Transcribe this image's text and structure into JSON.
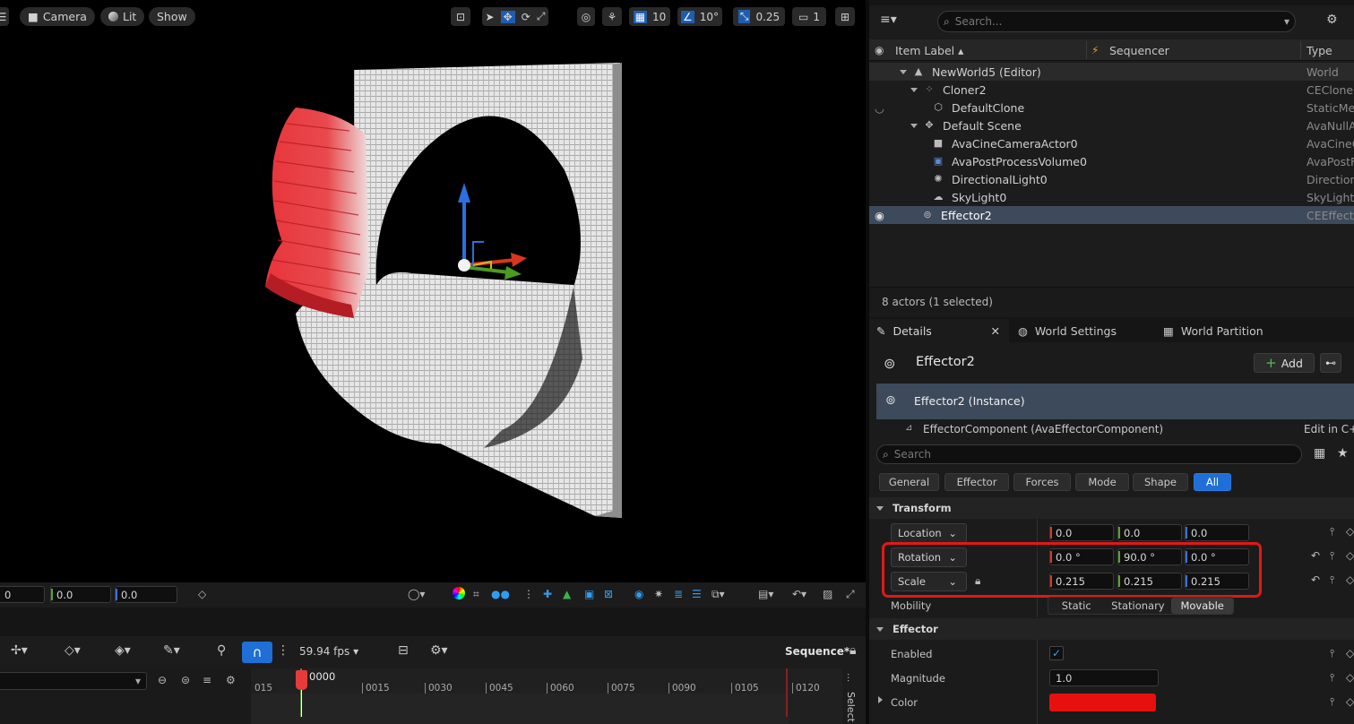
{
  "viewport": {
    "toolbar": {
      "camera_label": "Camera",
      "lit_label": "Lit",
      "show_label": "Show",
      "grid_value": "10",
      "angle_value": "10°",
      "scale_value": "0.25",
      "camera_speed_value": "1"
    },
    "bottom": {
      "field1": "0",
      "field2": "0.0",
      "field3": "0.0"
    }
  },
  "timeline": {
    "fps_label": "59.94 fps",
    "sequence_label": "Sequence*",
    "current_frame": "0000",
    "ticks": [
      "015",
      "0015",
      "0030",
      "0045",
      "0060",
      "0075",
      "0090",
      "0105",
      "0120"
    ],
    "side_label": "Select"
  },
  "outliner": {
    "search_placeholder": "Search...",
    "columns": {
      "label": "Item Label",
      "sequencer": "Sequencer",
      "type": "Type"
    },
    "items": [
      {
        "label": "NewWorld5 (Editor)",
        "type": "World"
      },
      {
        "label": "Cloner2",
        "type": "CECloner"
      },
      {
        "label": "DefaultClone",
        "type": "StaticMe"
      },
      {
        "label": "Default Scene",
        "type": "AvaNullA"
      },
      {
        "label": "AvaCineCameraActor0",
        "type": "AvaCineC"
      },
      {
        "label": "AvaPostProcessVolume0",
        "type": "AvaPostF"
      },
      {
        "label": "DirectionalLight0",
        "type": "Direction"
      },
      {
        "label": "SkyLight0",
        "type": "SkyLight"
      },
      {
        "label": "Effector2",
        "type": "CEEffecto"
      }
    ],
    "status": "8 actors (1 selected)"
  },
  "details": {
    "tabs": [
      "Details",
      "World Settings",
      "World Partition"
    ],
    "actor_name": "Effector2",
    "add_label": "Add",
    "instance_label": "Effector2 (Instance)",
    "component_label": "EffectorComponent (AvaEffectorComponent)",
    "edit_label": "Edit in C++",
    "search_placeholder": "Search",
    "filters": [
      "General",
      "Effector",
      "Forces",
      "Mode",
      "Shape",
      "All"
    ],
    "transform": {
      "header": "Transform",
      "location": {
        "label": "Location",
        "x": "0.0",
        "y": "0.0",
        "z": "0.0"
      },
      "rotation": {
        "label": "Rotation",
        "x": "0.0 °",
        "y": "90.0 °",
        "z": "0.0 °"
      },
      "scale": {
        "label": "Scale",
        "x": "0.215",
        "y": "0.215",
        "z": "0.215"
      },
      "mobility": {
        "label": "Mobility",
        "options": [
          "Static",
          "Stationary",
          "Movable"
        ]
      }
    },
    "effector": {
      "header": "Effector",
      "enabled_label": "Enabled",
      "magnitude_label": "Magnitude",
      "magnitude_value": "1.0",
      "color_label": "Color",
      "color_value": "#e8100f"
    }
  }
}
